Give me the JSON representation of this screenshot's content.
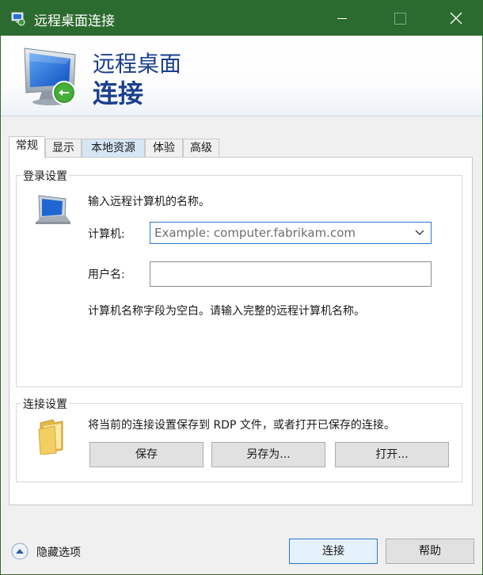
{
  "window": {
    "title": "远程桌面连接"
  },
  "banner": {
    "line1": "远程桌面",
    "line2": "连接"
  },
  "tabs": [
    {
      "label": "常规",
      "active": true
    },
    {
      "label": "显示",
      "active": false
    },
    {
      "label": "本地资源",
      "active": false
    },
    {
      "label": "体验",
      "active": false
    },
    {
      "label": "高级",
      "active": false
    }
  ],
  "login_settings": {
    "title": "登录设置",
    "instruction": "输入远程计算机的名称。",
    "computer_label": "计算机:",
    "computer_placeholder": "Example: computer.fabrikam.com",
    "username_label": "用户名:",
    "username_value": "",
    "empty_warning": "计算机名称字段为空白。请输入完整的远程计算机名称。"
  },
  "connection_settings": {
    "title": "连接设置",
    "description": "将当前的连接设置保存到 RDP 文件，或者打开已保存的连接。",
    "save_label": "保存",
    "save_as_label": "另存为...",
    "open_label": "打开..."
  },
  "footer": {
    "hide_options_label": "隐藏选项",
    "connect_label": "连接",
    "help_label": "帮助"
  },
  "colors": {
    "titlebar": "#2c6b2f",
    "banner_text": "#1b3f8f",
    "focus_border": "#2b78c7"
  }
}
